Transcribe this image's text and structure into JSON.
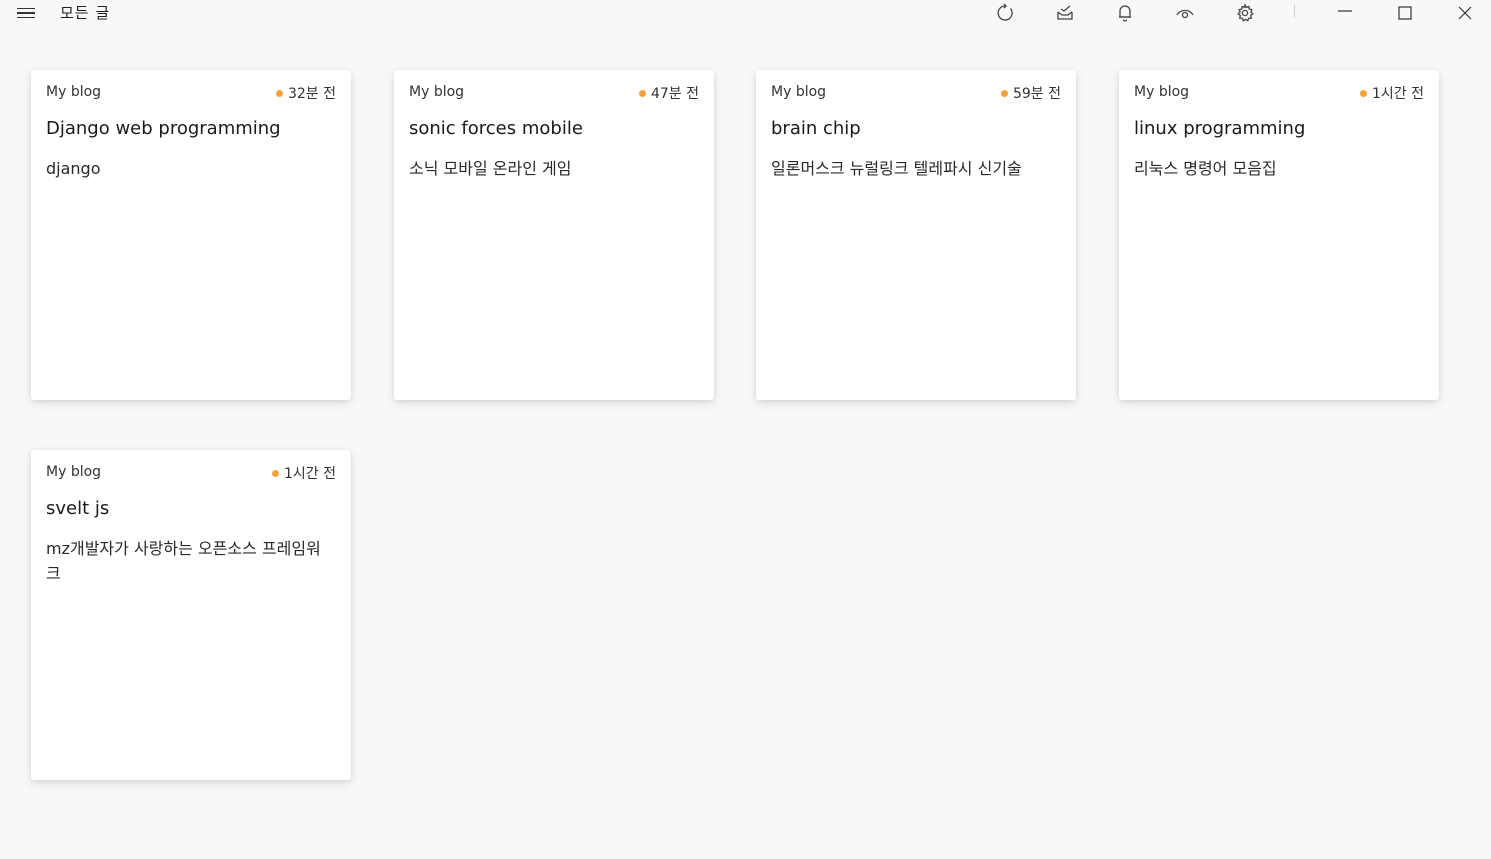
{
  "app": {
    "title": "모든 글"
  },
  "icons": {
    "menu": "hamburger-menu-icon",
    "refresh": "refresh-icon",
    "inbox": "inbox-icon",
    "notification": "bell-icon",
    "view": "eye-icon",
    "settings": "gear-icon",
    "minimize": "minimize-icon",
    "maximize": "maximize-icon",
    "close": "close-icon"
  },
  "colors": {
    "accent_dot": "#f4a23b",
    "background": "#f9f8f7",
    "card": "#ffffff"
  },
  "cards": [
    {
      "blog": "My blog",
      "time": "32분 전",
      "title": "Django web programming",
      "body": "django"
    },
    {
      "blog": "My blog",
      "time": "47분 전",
      "title": "sonic forces mobile",
      "body": "소닉 모바일 온라인 게임"
    },
    {
      "blog": "My blog",
      "time": "59분 전",
      "title": "brain chip",
      "body": "일론머스크 뉴럴링크 텔레파시 신기술"
    },
    {
      "blog": "My blog",
      "time": "1시간 전",
      "title": "linux programming",
      "body": "리눅스 명령어 모음집"
    },
    {
      "blog": "My blog",
      "time": "1시간 전",
      "title": "svelt js",
      "body": "mz개발자가 사랑하는 오픈소스 프레임워크"
    }
  ]
}
